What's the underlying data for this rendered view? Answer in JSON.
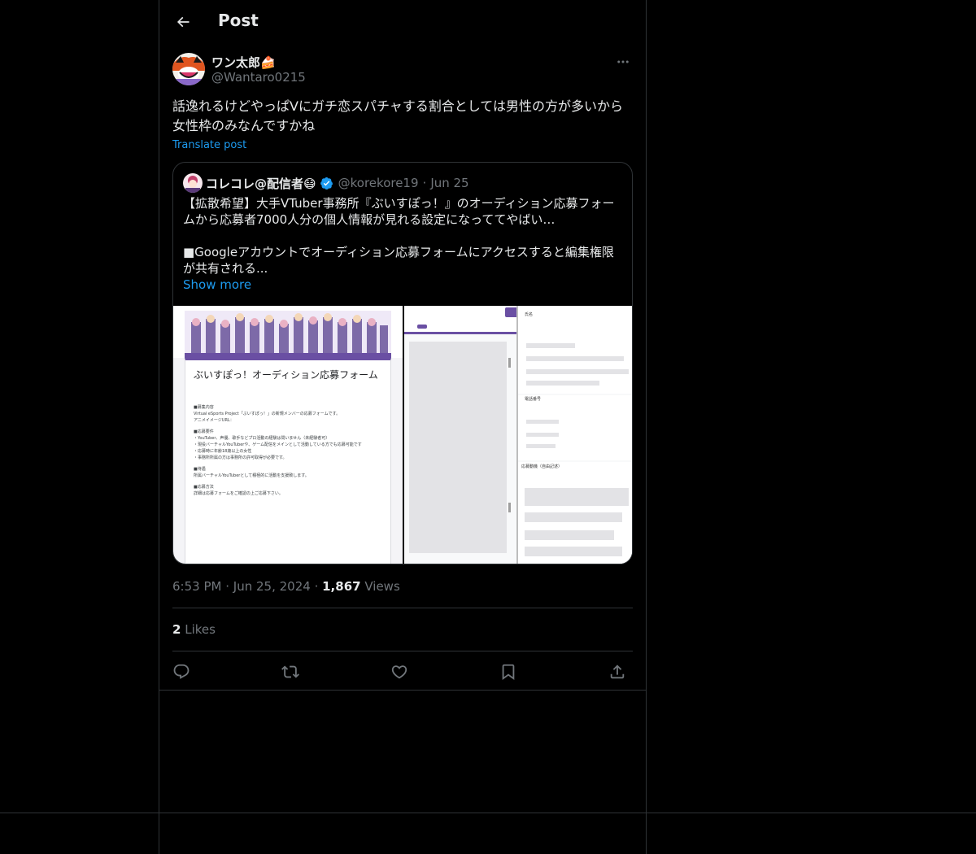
{
  "header": {
    "title": "Post"
  },
  "post": {
    "author_name": "ワン太郎🍰",
    "author_handle": "@Wantaro0215",
    "text": "話逸れるけどやっぱVにガチ恋スパチャする割合としては男性の方が多いから女性枠のみなんですかね",
    "translate_label": "Translate post",
    "time": "6:53 PM",
    "date": "Jun 25, 2024",
    "views_count": "1,867",
    "views_label": "Views",
    "likes_count": "2",
    "likes_label": "Likes"
  },
  "quote": {
    "author_name": "コレコレ@配信者😷",
    "author_handle": "@korekore19",
    "date": "Jun 25",
    "text": "【拡散希望】大手VTuber事務所『ぶいすぽっ！』のオーディション応募フォームから応募者7000人分の個人情報が見れる設定になっててやばい…\n\n■Googleアカウントでオーディション応募フォームにアクセスすると編集権限が共有される...",
    "show_more": "Show more",
    "image1": {
      "form_title": "ぶいすぽっ！オーディション応募フォーム",
      "lines": [
        "■募集内容",
        "Virtual eSports Project「ぶいすぽっ！」の新規メンバーの応募フォームです。",
        "アニメイメージURL：",
        "■応募要件",
        "・YouTuber、声優、歌手などプロ活動の経験は問いません（未経験者可）",
        "・現役バーチャルYouTuberや、ゲーム配信をメインとして活動している方でも応募可能です",
        "・応募時に年齢18歳以上の女性",
        "・事務所所属の方は事務所の許可取得が必要です。",
        "■待遇",
        "所属バーチャルYouTuberとして積極的に活動を支援致します。",
        "■応募方法",
        "詳細は応募フォームをご確認の上ご応募下さい。"
      ]
    },
    "image2": {
      "field1": "氏名",
      "field2": "電話番号",
      "field3": "応募動機（自由記述）"
    }
  },
  "actions": {
    "reply": "reply-icon",
    "repost": "repost-icon",
    "like": "heart-icon",
    "bookmark": "bookmark-icon",
    "share": "share-icon"
  },
  "colors": {
    "background": "#000000",
    "text": "#e7e9ea",
    "muted": "#71767b",
    "accent": "#1d9bf0",
    "border": "#2f3336"
  }
}
